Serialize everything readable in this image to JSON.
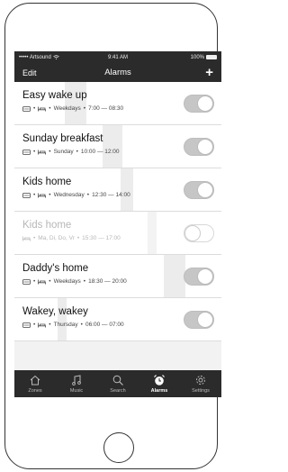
{
  "status": {
    "carrier": "••••• Artsound",
    "time": "9:41 AM",
    "battery": "100%"
  },
  "nav": {
    "edit": "Edit",
    "title": "Alarms",
    "add": "+"
  },
  "alarms": [
    {
      "name": "Easy wake up",
      "schedule": "Weekdays",
      "time": "7:00 — 08:30",
      "enabled": true,
      "icons": [
        "speaker-icon",
        "bed-icon"
      ]
    },
    {
      "name": "Sunday breakfast",
      "schedule": "Sunday",
      "time": "10:00 — 12:00",
      "enabled": true,
      "icons": [
        "speaker-icon",
        "bed-icon"
      ]
    },
    {
      "name": "Kids home",
      "schedule": "Wednesday",
      "time": "12:30 — 14:00",
      "enabled": true,
      "icons": [
        "speaker-icon",
        "bed-icon"
      ]
    },
    {
      "name": "Kids home",
      "schedule": "Ma, Di, Do, Vr",
      "time": "15:30 — 17:00",
      "enabled": false,
      "icons": [
        "bed-icon"
      ]
    },
    {
      "name": "Daddy's home",
      "schedule": "Weekdays",
      "time": "18:30 — 20:00",
      "enabled": true,
      "icons": [
        "speaker-icon",
        "bed-icon"
      ]
    },
    {
      "name": "Wakey, wakey",
      "schedule": "Thursday",
      "time": "06:00 — 07:00",
      "enabled": true,
      "icons": [
        "speaker-icon",
        "bed-icon"
      ]
    }
  ],
  "tabs": [
    {
      "label": "Zones",
      "icon": "home-icon",
      "active": false
    },
    {
      "label": "Music",
      "icon": "music-note-icon",
      "active": false
    },
    {
      "label": "Search",
      "icon": "search-icon",
      "active": false
    },
    {
      "label": "Alarms",
      "icon": "alarm-clock-icon",
      "active": true
    },
    {
      "label": "Settings",
      "icon": "gear-icon",
      "active": false
    }
  ]
}
